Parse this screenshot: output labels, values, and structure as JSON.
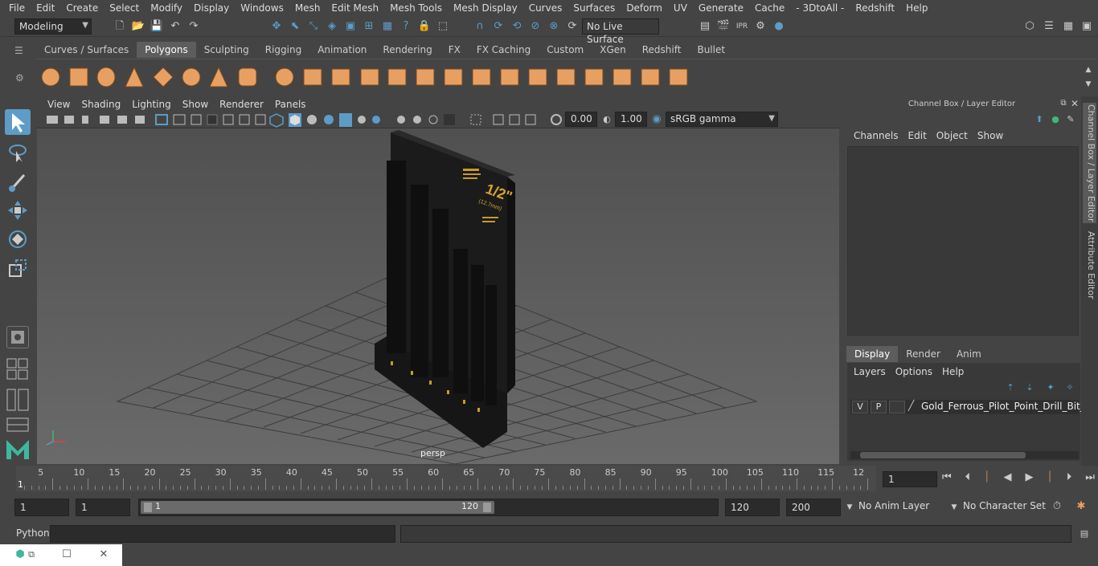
{
  "menubar": [
    "File",
    "Edit",
    "Create",
    "Select",
    "Modify",
    "Display",
    "Windows",
    "Mesh",
    "Edit Mesh",
    "Mesh Tools",
    "Mesh Display",
    "Curves",
    "Surfaces",
    "Deform",
    "UV",
    "Generate",
    "Cache",
    "- 3DtoAll -",
    "Redshift",
    "Help"
  ],
  "status": {
    "workspace": "Modeling",
    "live_surface": "No Live Surface"
  },
  "shelf_tabs": [
    "Curves / Surfaces",
    "Polygons",
    "Sculpting",
    "Rigging",
    "Animation",
    "Rendering",
    "FX",
    "FX Caching",
    "Custom",
    "XGen",
    "Redshift",
    "Bullet"
  ],
  "shelf_active": "Polygons",
  "viewport": {
    "menu": [
      "View",
      "Shading",
      "Lighting",
      "Show",
      "Renderer",
      "Panels"
    ],
    "exposure": "0.00",
    "gamma": "1.00",
    "colorspace": "sRGB gamma",
    "camera": "persp",
    "model_label_fraction": "1/2\"",
    "model_label_mm": "(12.7mm)"
  },
  "right_panel": {
    "title": "Channel Box / Layer Editor",
    "menu": [
      "Channels",
      "Edit",
      "Object",
      "Show"
    ],
    "layer_tabs": [
      "Display",
      "Render",
      "Anim"
    ],
    "layer_tab_active": "Display",
    "layer_menu": [
      "Layers",
      "Options",
      "Help"
    ],
    "layer_v": "V",
    "layer_p": "P",
    "layer_name": "Gold_Ferrous_Pilot_Point_Drill_Bit_Se"
  },
  "side_tabs": [
    "Channel Box / Layer Editor",
    "Attribute Editor"
  ],
  "timeline": {
    "ticks": [
      "5",
      "10",
      "15",
      "20",
      "25",
      "30",
      "35",
      "40",
      "45",
      "50",
      "55",
      "60",
      "65",
      "70",
      "75",
      "80",
      "85",
      "90",
      "95",
      "100",
      "105",
      "110",
      "115",
      "12"
    ],
    "start_label": "1",
    "current_frame": "1"
  },
  "range": {
    "start": "1",
    "start2": "1",
    "slider_start": "1",
    "slider_end": "120",
    "end": "120",
    "end2": "200",
    "anim_layer": "No Anim Layer",
    "char_set": "No Character Set"
  },
  "cmd": {
    "label": "Python"
  },
  "colors": {
    "accent": "#5d9cc6",
    "shelf_orange": "#e8a062",
    "shelf_green": "#3fb7a0",
    "bg": "#444444",
    "viewport": "#5c5c5c"
  }
}
